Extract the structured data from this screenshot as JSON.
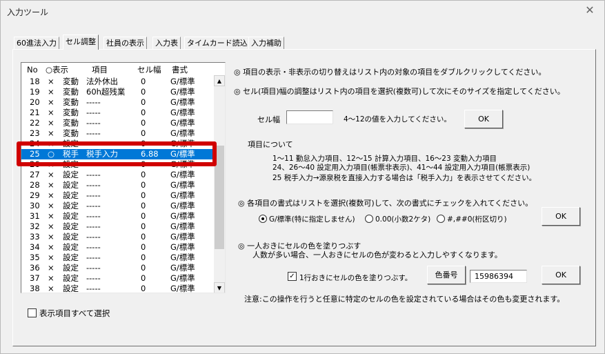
{
  "window": {
    "title": "入力ツール"
  },
  "tabs": [
    "60進法入力",
    "セル調整",
    "社員の表示",
    "入力表",
    "タイムカード読込",
    "入力補助"
  ],
  "list": {
    "headers": {
      "no": "No",
      "show": "○表示",
      "item": "項目",
      "width": "セル幅",
      "format": "書式"
    },
    "rows": [
      {
        "no": "18",
        "show": "×",
        "kind": "変動",
        "item": "法外休出",
        "width": "0",
        "format": "G/標準"
      },
      {
        "no": "19",
        "show": "×",
        "kind": "変動",
        "item": "60h超残業",
        "width": "0",
        "format": "G/標準"
      },
      {
        "no": "20",
        "show": "×",
        "kind": "変動",
        "item": "-----",
        "width": "0",
        "format": "G/標準"
      },
      {
        "no": "21",
        "show": "×",
        "kind": "変動",
        "item": "-----",
        "width": "0",
        "format": "G/標準"
      },
      {
        "no": "22",
        "show": "×",
        "kind": "変動",
        "item": "-----",
        "width": "0",
        "format": "G/標準"
      },
      {
        "no": "23",
        "show": "×",
        "kind": "変動",
        "item": "-----",
        "width": "0",
        "format": "G/標準"
      },
      {
        "no": "24",
        "show": "×",
        "kind": "設定",
        "item": "-----",
        "width": "0",
        "format": "G/標準"
      },
      {
        "no": "25",
        "show": "○",
        "kind": "税手",
        "item": "税手入力",
        "width": "6.88",
        "format": "G/標準",
        "selected": true
      },
      {
        "no": "26",
        "show": "×",
        "kind": "設定",
        "item": "-----",
        "width": "0",
        "format": "G/標準"
      },
      {
        "no": "27",
        "show": "×",
        "kind": "設定",
        "item": "-----",
        "width": "0",
        "format": "G/標準"
      },
      {
        "no": "28",
        "show": "×",
        "kind": "設定",
        "item": "-----",
        "width": "0",
        "format": "G/標準"
      },
      {
        "no": "29",
        "show": "×",
        "kind": "設定",
        "item": "-----",
        "width": "0",
        "format": "G/標準"
      },
      {
        "no": "30",
        "show": "×",
        "kind": "設定",
        "item": "-----",
        "width": "0",
        "format": "G/標準"
      },
      {
        "no": "31",
        "show": "×",
        "kind": "設定",
        "item": "-----",
        "width": "0",
        "format": "G/標準"
      },
      {
        "no": "32",
        "show": "×",
        "kind": "設定",
        "item": "-----",
        "width": "0",
        "format": "G/標準"
      },
      {
        "no": "33",
        "show": "×",
        "kind": "設定",
        "item": "-----",
        "width": "0",
        "format": "G/標準"
      },
      {
        "no": "34",
        "show": "×",
        "kind": "設定",
        "item": "-----",
        "width": "0",
        "format": "G/標準"
      },
      {
        "no": "35",
        "show": "×",
        "kind": "設定",
        "item": "-----",
        "width": "0",
        "format": "G/標準"
      },
      {
        "no": "36",
        "show": "×",
        "kind": "設定",
        "item": "-----",
        "width": "0",
        "format": "G/標準"
      },
      {
        "no": "37",
        "show": "×",
        "kind": "設定",
        "item": "-----",
        "width": "0",
        "format": "G/標準"
      },
      {
        "no": "38",
        "show": "×",
        "kind": "設定",
        "item": "-----",
        "width": "0",
        "format": "G/標準"
      }
    ],
    "scroll_up": "▲",
    "scroll_down": "▼"
  },
  "select_all_label": "表示項目すべて選択",
  "info": {
    "line1": "◎ 項目の表示・非表示の切り替えはリスト内の対象の項目をダブルクリックしてください。",
    "line2": "◎ セル(項目)幅の調整はリスト内の項目を選択(複数可)して次にそのサイズを指定してください。"
  },
  "cell_width": {
    "label": "セル幅",
    "value": "",
    "hint": "4～12の値を入力してください。",
    "ok": "OK"
  },
  "about": {
    "heading": "項目について",
    "line1": "1～11 勤怠入力項目、12～15 計算入力項目、16～23 変動入力項目",
    "line2": "24、26～40 設定用入力項目(帳票非表示)、41～44 設定用入力項目(帳票表示)",
    "line3": "25 税手入力→源泉税を直接入力する場合は「税手入力」を表示させてください。"
  },
  "format": {
    "heading": "◎ 各項目の書式はリストを選択(複数可)して、次の書式にチェックを入れてください。",
    "options": [
      "G/標準(特に指定しません)",
      "0.00(小数2ケタ)",
      "#,##0(桁区切り)"
    ],
    "selected_index": 0,
    "ok": "OK"
  },
  "color": {
    "heading": "◎ 一人おきにセルの色を塗りつぶす",
    "desc": "人数が多い場合、一人おきにセルの色が変わると入力しやすくなります。",
    "checkbox_label": "1行おきにセルの色を塗りつぶす。",
    "checked": true,
    "color_button": "色番号",
    "color_value": "15986394",
    "ok": "OK"
  },
  "note": "注意:この操作を行うと任意に特定のセルの色を設定されている場合はその色も変更されます。"
}
